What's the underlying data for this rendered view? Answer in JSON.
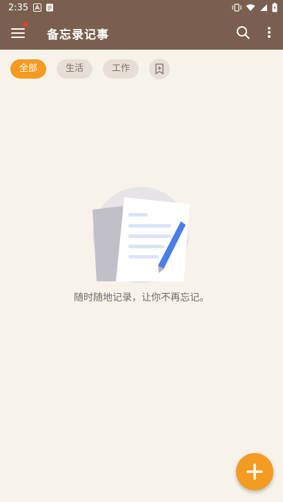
{
  "status_bar": {
    "time": "2:35",
    "icons": [
      "a-notification-icon",
      "doc-notification-icon",
      "vibrate-icon",
      "wifi-icon",
      "signal-icon",
      "battery-charging-icon"
    ]
  },
  "app_bar": {
    "title": "备忘录记事",
    "menu_icon": "menu-icon",
    "search_icon": "search-icon",
    "more_icon": "more-vert-icon",
    "color": "#7a5f4e"
  },
  "filters": [
    {
      "label": "全部",
      "active": true
    },
    {
      "label": "生活",
      "active": false
    },
    {
      "label": "工作",
      "active": false
    }
  ],
  "filter_add_icon": "add-category-icon",
  "empty_state": {
    "message": "随时随地记录，让你不再忘记。",
    "illustration": "notes-illustration"
  },
  "fab": {
    "icon": "plus-icon",
    "color": "#f39b22"
  },
  "background": "#f8f3ea",
  "accent": "#f39b22"
}
